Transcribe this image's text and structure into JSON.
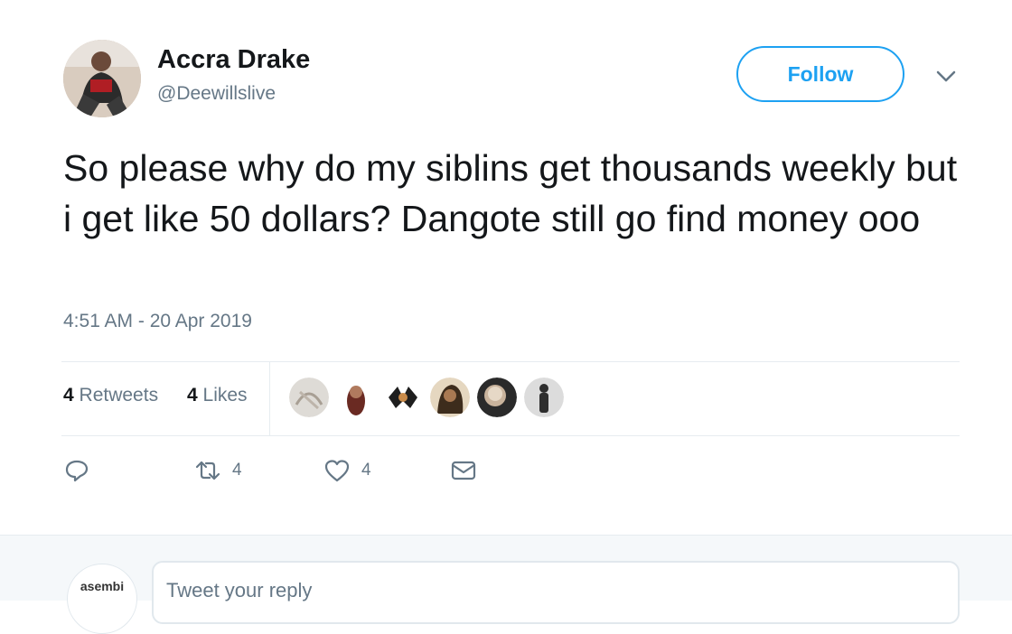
{
  "tweet": {
    "author": {
      "display_name": "Accra Drake",
      "handle": "@Deewillslive"
    },
    "follow_label": "Follow",
    "text": "So please why do my siblins get thousands weekly but i get like 50 dollars? Dangote still go find money ooo",
    "timestamp": "4:51 AM - 20 Apr 2019",
    "stats": {
      "retweets_count": "4",
      "retweets_label": "Retweets",
      "likes_count": "4",
      "likes_label": "Likes"
    },
    "actions": {
      "retweet_count": "4",
      "like_count": "4"
    }
  },
  "reply": {
    "placeholder": "Tweet your reply",
    "avatar_text": "asembi"
  },
  "icons": [
    "chevron-down-icon",
    "reply-icon",
    "retweet-icon",
    "heart-icon",
    "message-icon"
  ],
  "colors": {
    "accent": "#1da1f2",
    "secondary_text": "#657786",
    "border": "#e6ecf0"
  }
}
